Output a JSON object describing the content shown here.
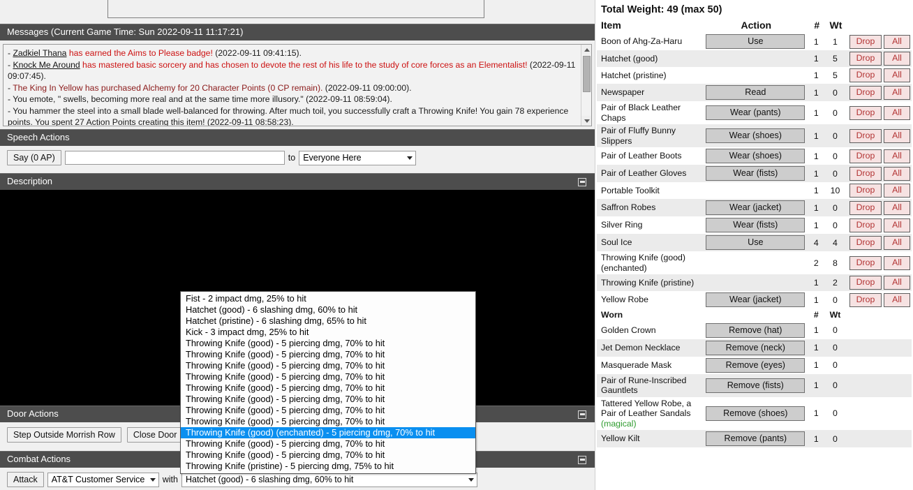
{
  "messages": {
    "header": "Messages (Current Game Time: Sun 2022-09-11 11:17:21)",
    "lines": [
      {
        "prefix": "- ",
        "name": "Zadkiel Thana",
        "body": " has earned the Aims to Please badge!",
        "time": " (2022-09-11 09:41:15).",
        "style": "red"
      },
      {
        "prefix": "- ",
        "name": "Knock Me Around",
        "body": " has mastered basic sorcery and has chosen to devote the rest of his life to the study of core forces as an Elementalist!",
        "time": " (2022-09-11 09:07:45).",
        "style": "red"
      },
      {
        "prefix": "- ",
        "name": "",
        "body": "The King In Yellow has purchased Alchemy for 20 Character Points (0 CP remain).",
        "time": " (2022-09-11 09:00:00).",
        "style": "dark"
      },
      {
        "prefix": "- ",
        "name": "",
        "body": "You emote, \" swells, becoming more real and at the same time more illusory.\"",
        "time": " (2022-09-11 08:59:04).",
        "style": "black"
      },
      {
        "prefix": "- ",
        "name": "",
        "body": "You hammer the steel into a small blade well-balanced for throwing. After much toil, you successfully craft a Throwing Knife! You gain 78 experience points. You spent 27 Action Points creating this item!",
        "time": " (2022-09-11 08:58:23).",
        "style": "black"
      }
    ]
  },
  "speech": {
    "header": "Speech Actions",
    "say_label": "Say (0 AP)",
    "input_value": "",
    "to_label": "to",
    "target_selected": "Everyone Here"
  },
  "description": {
    "header": "Description",
    "collapse_icon": "collapse-icon"
  },
  "door": {
    "header": "Door Actions",
    "buttons": [
      "Step Outside Morrish Row",
      "Close Door"
    ]
  },
  "combat": {
    "header": "Combat Actions",
    "attack_label": "Attack",
    "target_selected": "AT&T Customer Service",
    "with_label": "with",
    "weapon_selected": "Hatchet (good) - 6 slashing dmg, 60% to hit"
  },
  "weapon_dropdown": {
    "open": true,
    "selected_index": 12,
    "options": [
      "Fist - 2 impact dmg, 25% to hit",
      "Hatchet (good) - 6 slashing dmg, 60% to hit",
      "Hatchet (pristine) - 6 slashing dmg, 65% to hit",
      "Kick - 3 impact dmg, 25% to hit",
      "Throwing Knife (good) - 5 piercing dmg, 70% to hit",
      "Throwing Knife (good) - 5 piercing dmg, 70% to hit",
      "Throwing Knife (good) - 5 piercing dmg, 70% to hit",
      "Throwing Knife (good) - 5 piercing dmg, 70% to hit",
      "Throwing Knife (good) - 5 piercing dmg, 70% to hit",
      "Throwing Knife (good) - 5 piercing dmg, 70% to hit",
      "Throwing Knife (good) - 5 piercing dmg, 70% to hit",
      "Throwing Knife (good) - 5 piercing dmg, 70% to hit",
      "Throwing Knife (good) (enchanted) - 5 piercing dmg, 70% to hit",
      "Throwing Knife (good) - 5 piercing dmg, 70% to hit",
      "Throwing Knife (good) - 5 piercing dmg, 70% to hit",
      "Throwing Knife (pristine) - 5 piercing dmg, 75% to hit"
    ]
  },
  "inventory": {
    "total_weight": "Total Weight: 49 (max 50)",
    "columns": {
      "item": "Item",
      "action": "Action",
      "count": "#",
      "weight": "Wt"
    },
    "drop_label": "Drop",
    "all_label": "All",
    "items": [
      {
        "name": "Boon of Ahg-Za-Haru",
        "action": "Use",
        "count": "1",
        "wt": "1"
      },
      {
        "name": "Hatchet (good)",
        "action": "",
        "count": "1",
        "wt": "5"
      },
      {
        "name": "Hatchet (pristine)",
        "action": "",
        "count": "1",
        "wt": "5"
      },
      {
        "name": "Newspaper",
        "action": "Read",
        "count": "1",
        "wt": "0"
      },
      {
        "name": "Pair of Black Leather Chaps",
        "action": "Wear (pants)",
        "count": "1",
        "wt": "0"
      },
      {
        "name": "Pair of Fluffy Bunny Slippers",
        "action": "Wear (shoes)",
        "count": "1",
        "wt": "0"
      },
      {
        "name": "Pair of Leather Boots",
        "action": "Wear (shoes)",
        "count": "1",
        "wt": "0"
      },
      {
        "name": "Pair of Leather Gloves",
        "action": "Wear (fists)",
        "count": "1",
        "wt": "0"
      },
      {
        "name": "Portable Toolkit",
        "action": "",
        "count": "1",
        "wt": "10"
      },
      {
        "name": "Saffron Robes",
        "action": "Wear (jacket)",
        "count": "1",
        "wt": "0"
      },
      {
        "name": "Silver Ring",
        "action": "Wear (fists)",
        "count": "1",
        "wt": "0"
      },
      {
        "name": "Soul Ice",
        "action": "Use",
        "count": "4",
        "wt": "4"
      },
      {
        "name": "Throwing Knife (good) (enchanted)",
        "action": "",
        "count": "2",
        "wt": "8"
      },
      {
        "name": "Throwing Knife (pristine)",
        "action": "",
        "count": "1",
        "wt": "2"
      },
      {
        "name": "Yellow Robe",
        "action": "Wear (jacket)",
        "count": "1",
        "wt": "0"
      }
    ],
    "worn_header": "Worn",
    "worn": [
      {
        "name": "Golden Crown",
        "action": "Remove (hat)",
        "count": "1",
        "wt": "0"
      },
      {
        "name": "Jet Demon Necklace",
        "action": "Remove (neck)",
        "count": "1",
        "wt": "0"
      },
      {
        "name": "Masquerade Mask",
        "action": "Remove (eyes)",
        "count": "1",
        "wt": "0"
      },
      {
        "name": "Pair of Rune-Inscribed Gauntlets",
        "action": "Remove (fists)",
        "count": "1",
        "wt": "0"
      },
      {
        "name": "Tattered Yellow Robe, a Pair of Leather Sandals",
        "suffix": "(magical)",
        "action": "Remove (shoes)",
        "count": "1",
        "wt": "0"
      },
      {
        "name": "Yellow Kilt",
        "action": "Remove (pants)",
        "count": "1",
        "wt": "0"
      }
    ]
  },
  "colors": {
    "panel_header_bg": "#4d4d4d",
    "selection_blue": "#0a8ff0",
    "drop_red": "#b23232",
    "magical_green": "#2e9b2e",
    "message_red": "#cc1111"
  }
}
